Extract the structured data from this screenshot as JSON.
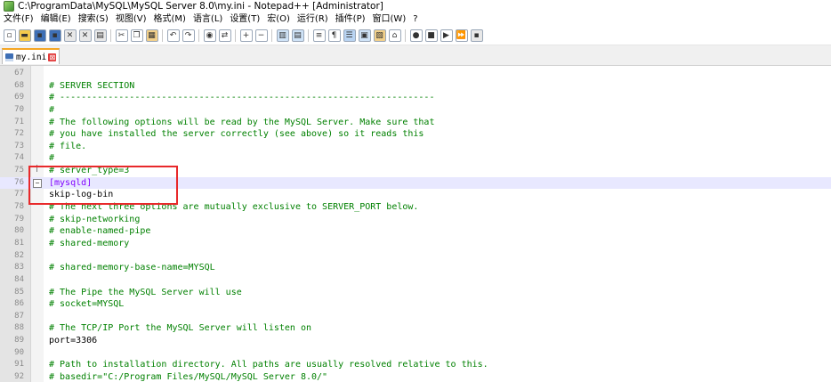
{
  "window": {
    "title": "C:\\ProgramData\\MySQL\\MySQL Server 8.0\\my.ini - Notepad++ [Administrator]"
  },
  "menu": [
    "文件(F)",
    "编辑(E)",
    "搜索(S)",
    "视图(V)",
    "格式(M)",
    "语言(L)",
    "设置(T)",
    "宏(O)",
    "运行(R)",
    "插件(P)",
    "窗口(W)",
    "?"
  ],
  "toolbar": {
    "groups": [
      [
        {
          "icon": "new-file-icon",
          "glyph": "▫",
          "color": "#ffffff"
        },
        {
          "icon": "open-file-icon",
          "glyph": "▬",
          "color": "#f2c94c"
        },
        {
          "icon": "save-icon",
          "glyph": "▪",
          "color": "#3e6fb5"
        },
        {
          "icon": "save-all-icon",
          "glyph": "▪",
          "color": "#3e6fb5"
        },
        {
          "icon": "close-icon",
          "glyph": "✕",
          "color": "#e8e8e8"
        },
        {
          "icon": "close-all-icon",
          "glyph": "✕",
          "color": "#e8e8e8"
        },
        {
          "icon": "print-icon",
          "glyph": "▤",
          "color": "#e8e8e8"
        }
      ],
      [
        {
          "icon": "cut-icon",
          "glyph": "✂",
          "color": "#ffffff"
        },
        {
          "icon": "copy-icon",
          "glyph": "❐",
          "color": "#ffffff"
        },
        {
          "icon": "paste-icon",
          "glyph": "▦",
          "color": "#f2d08a"
        }
      ],
      [
        {
          "icon": "undo-icon",
          "glyph": "↶",
          "color": "#ffffff"
        },
        {
          "icon": "redo-icon",
          "glyph": "↷",
          "color": "#ffffff"
        }
      ],
      [
        {
          "icon": "find-icon",
          "glyph": "◉",
          "color": "#ffffff"
        },
        {
          "icon": "replace-icon",
          "glyph": "⇄",
          "color": "#ffffff"
        }
      ],
      [
        {
          "icon": "zoom-in-icon",
          "glyph": "+",
          "color": "#ffffff"
        },
        {
          "icon": "zoom-out-icon",
          "glyph": "−",
          "color": "#ffffff"
        }
      ],
      [
        {
          "icon": "sync-vertical-icon",
          "glyph": "▥",
          "color": "#cfe3f7"
        },
        {
          "icon": "sync-horizontal-icon",
          "glyph": "▤",
          "color": "#cfe3f7"
        }
      ],
      [
        {
          "icon": "word-wrap-icon",
          "glyph": "≡",
          "color": "#ffffff"
        },
        {
          "icon": "show-all-chars-icon",
          "glyph": "¶",
          "color": "#ffffff"
        },
        {
          "icon": "indent-guide-icon",
          "glyph": "☰",
          "color": "#b9d4f2"
        },
        {
          "icon": "doc-map-icon",
          "glyph": "▣",
          "color": "#cfe3f7"
        },
        {
          "icon": "function-list-icon",
          "glyph": "▧",
          "color": "#f2d08a"
        },
        {
          "icon": "folder-as-workspace-icon",
          "glyph": "⌂",
          "color": "#ffffff"
        }
      ],
      [
        {
          "icon": "record-macro-icon",
          "glyph": "●",
          "color": "#ffffff"
        },
        {
          "icon": "stop-record-icon",
          "glyph": "■",
          "color": "#ffffff"
        },
        {
          "icon": "playback-icon",
          "glyph": "▶",
          "color": "#ffffff"
        },
        {
          "icon": "run-macro-multiple-icon",
          "glyph": "⏩",
          "color": "#ffffff"
        },
        {
          "icon": "save-macro-icon",
          "glyph": "▪",
          "color": "#e8e8e8"
        }
      ]
    ]
  },
  "tab": {
    "label": "my.ini",
    "close_glyph": "⊠"
  },
  "editor": {
    "current_line": 76,
    "lines": [
      {
        "n": "67",
        "text": "",
        "type": "plain"
      },
      {
        "n": "68",
        "text": "# SERVER SECTION",
        "type": "comment"
      },
      {
        "n": "69",
        "text": "# ----------------------------------------------------------------------",
        "type": "comment"
      },
      {
        "n": "70",
        "text": "#",
        "type": "comment"
      },
      {
        "n": "71",
        "text": "# The following options will be read by the MySQL Server. Make sure that",
        "type": "comment"
      },
      {
        "n": "72",
        "text": "# you have installed the server correctly (see above) so it reads this",
        "type": "comment"
      },
      {
        "n": "73",
        "text": "# file.",
        "type": "comment"
      },
      {
        "n": "74",
        "text": "#",
        "type": "comment"
      },
      {
        "n": "75",
        "text": "# server_type=3",
        "type": "comment",
        "fold": "end"
      },
      {
        "n": "76",
        "text": "[mysqld]",
        "type": "section",
        "fold": "open"
      },
      {
        "n": "77",
        "text": "skip-log-bin",
        "type": "key"
      },
      {
        "n": "78",
        "text": "# The next three options are mutually exclusive to SERVER_PORT below.",
        "type": "comment"
      },
      {
        "n": "79",
        "text": "# skip-networking",
        "type": "comment"
      },
      {
        "n": "80",
        "text": "# enable-named-pipe",
        "type": "comment"
      },
      {
        "n": "81",
        "text": "# shared-memory",
        "type": "comment"
      },
      {
        "n": "82",
        "text": "",
        "type": "plain"
      },
      {
        "n": "83",
        "text": "# shared-memory-base-name=MYSQL",
        "type": "comment"
      },
      {
        "n": "84",
        "text": "",
        "type": "plain"
      },
      {
        "n": "85",
        "text": "# The Pipe the MySQL Server will use",
        "type": "comment"
      },
      {
        "n": "86",
        "text": "# socket=MYSQL",
        "type": "comment"
      },
      {
        "n": "87",
        "text": "",
        "type": "plain"
      },
      {
        "n": "88",
        "text": "# The TCP/IP Port the MySQL Server will listen on",
        "type": "comment"
      },
      {
        "n": "89",
        "text": "port=3306",
        "type": "key"
      },
      {
        "n": "90",
        "text": "",
        "type": "plain"
      },
      {
        "n": "91",
        "text": "# Path to installation directory. All paths are usually resolved relative to this.",
        "type": "comment"
      },
      {
        "n": "92",
        "text": "# basedir=\"C:/Program Files/MySQL/MySQL Server 8.0/\"",
        "type": "comment"
      }
    ]
  }
}
